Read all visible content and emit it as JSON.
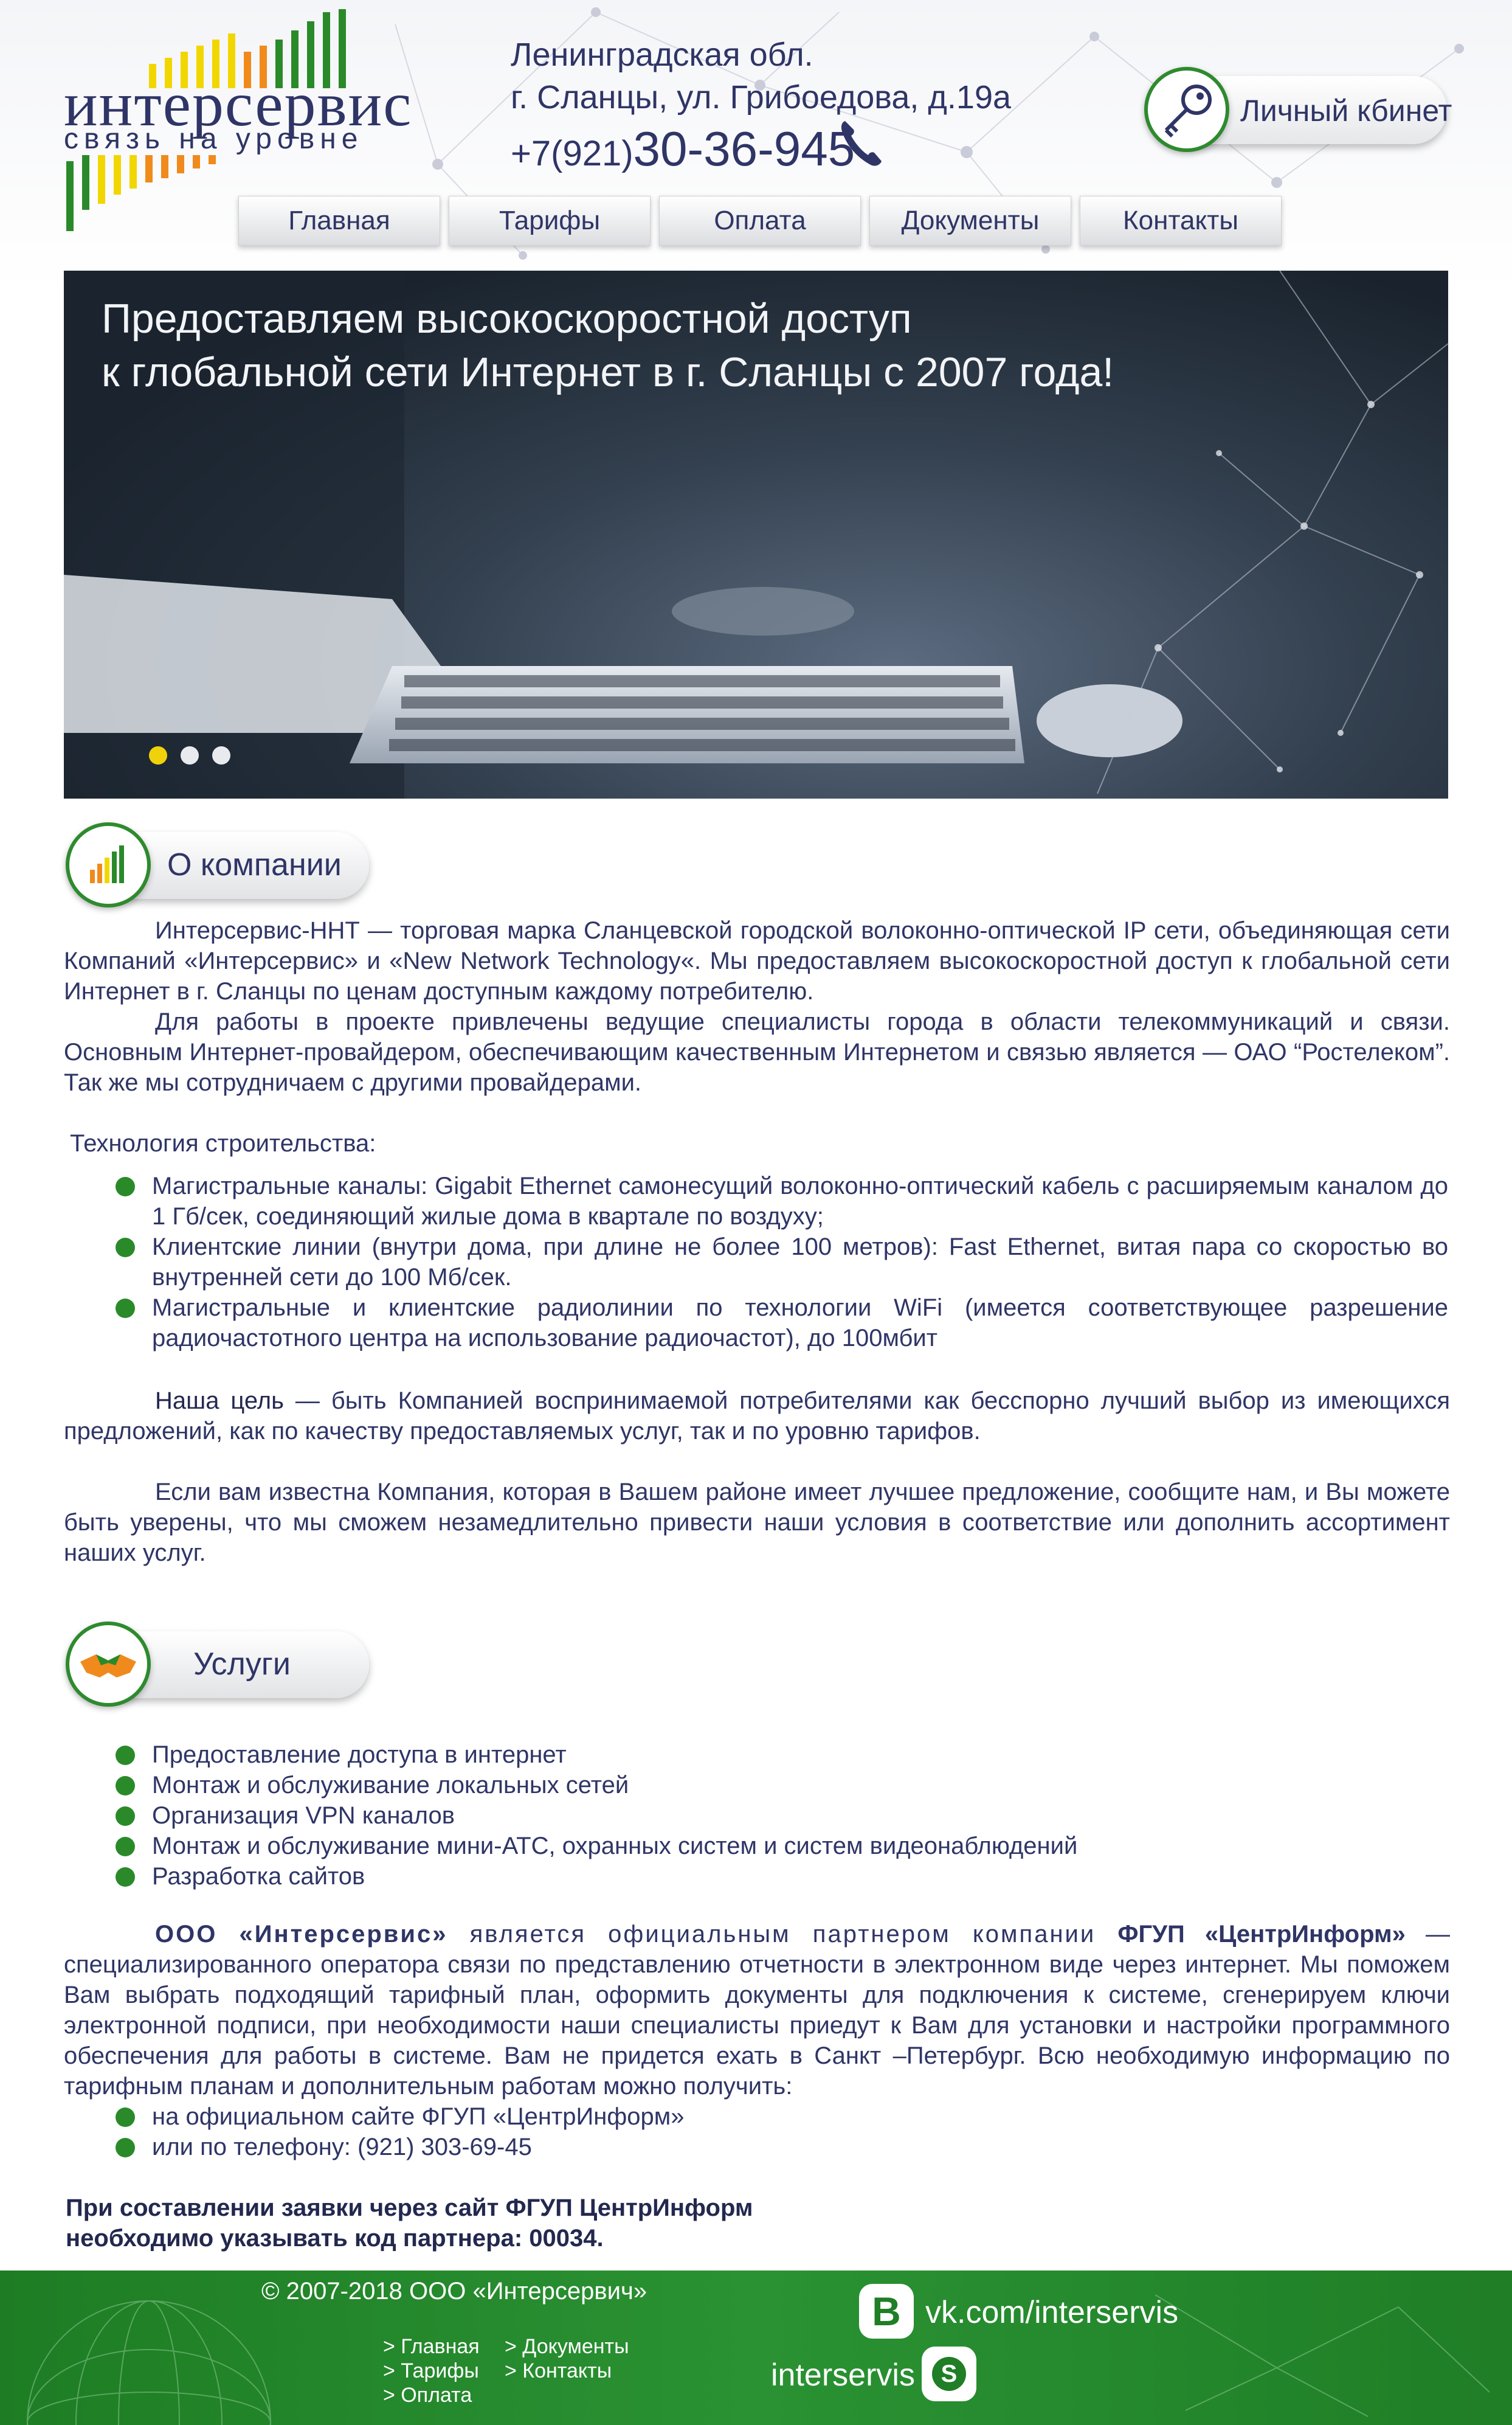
{
  "colors": {
    "brand_blue": "#2f3566",
    "brand_green": "#2a8a2a",
    "bar_yellow": "#f2d600",
    "bar_orange": "#f08a1c",
    "footer_green": "#1f7e26"
  },
  "header": {
    "logo_word": "интерсервис",
    "logo_tagline": "связь на уровне",
    "address_line1": "Ленинградская обл.",
    "address_line2": "г. Сланцы, ул. Грибоедова, д.19а",
    "phone_prefix": "+7(921)",
    "phone_number": "30-36-945",
    "phone_icon": "phone-icon",
    "cabinet_label": "Личный кбинет",
    "cabinet_icon": "key-icon"
  },
  "nav": {
    "items": [
      {
        "label": "Главная"
      },
      {
        "label": "Тарифы"
      },
      {
        "label": "Оплата"
      },
      {
        "label": "Документы"
      },
      {
        "label": "Контакты"
      }
    ]
  },
  "banner": {
    "title_line1": "Предоставляем высокоскоростной доступ",
    "title_line2": "к глобальной сети Интернет в г. Сланцы с 2007 года!",
    "slide_count": 3,
    "active_slide": 1
  },
  "about": {
    "title": "О компании",
    "icon": "signal-bars-icon",
    "p1_strong": "Интерсервис-ННТ",
    "p1": " — торговая марка Сланцевской городской волоконно-оптической IP сети, объединяющая сети Компаний «Интерсервис» и «New Network Technology«. Мы предоставляем высокоскоростной доступ к глобальной сети Интернет в г. Сланцы по ценам доступным каждому потребителю.",
    "p2": "Для работы в проекте привлечены ведущие специалисты города в области телекоммуникаций и связи. Основным Интернет-провайдером, обеспечивающим качественным Интернетом и связью является — ОАО “Ростелеком”. Так же мы сотрудничаем с другими провайдерами.",
    "tech_heading": "Технология строительства:",
    "tech_items": [
      "Магистральные каналы: Gigabit Ethernet самонесущий волоконно-оптический кабель с расширяемым каналом до 1 Гб/сек, соединяющий жилые дома в квартале по воздуху;",
      "Клиентские линии (внутри дома, при длине не более 100 метров): Fast Ethernet, витая пара со скоростью во внутренней сети до 100 Мб/сек.",
      "Магистральные и клиентские радиолинии по технологии WiFi (имеется соответствующее разрешение радиочастотного центра на использование радиочастот), до 100мбит"
    ],
    "goal_strong": "Наша цель",
    "goal": " — быть Компанией воспринимаемой потребителями как бесспорно лучший выбор из имеющихся предложений, как по качеству предоставляемых услуг, так и по уровню тарифов.",
    "offer": "Если вам известна Компания, которая в Вашем районе имеет лучшее предложение, сообщите нам, и Вы можете быть уверены, что мы сможем незамедлительно привести наши условия в соответствие или дополнить ассортимент наших услуг."
  },
  "services": {
    "title": "Услуги",
    "icon": "handshake-icon",
    "items": [
      "Предоставление доступа в интернет",
      "Монтаж и обслуживание локальных сетей",
      "Организация VPN каналов",
      "Монтаж и обслуживание мини-АТС, охранных систем и систем видеонаблюдений",
      "Разработка сайтов"
    ],
    "partner_strong1": "ООО «Интерсервис»",
    "partner_mid": " является официальным партнером компании ",
    "partner_strong2": "ФГУП «ЦентрИнформ»",
    "partner_rest": " — специализированного оператора связи по представлению отчетности в электронном виде через интернет. Мы поможем Вам выбрать подходящий тарифный план, оформить документы для подключения к системе, сгенерируем ключи электронной подписи, при необходимости наши специалисты приедут к Вам для установки и настройки программного обеспечения для работы в системе. Вам не придется ехать в Санкт –Петербург. Всю необходимую информацию по тарифным планам и дополнительным работам можно получить:",
    "contact_items": [
      "на официальном сайте ФГУП «ЦентрИнформ»",
      "или по телефону: (921) 303-69-45"
    ],
    "note_line1": "При составлении заявки через сайт ФГУП ЦентрИнформ",
    "note_line2": "необходимо указывать код партнера: 00034."
  },
  "footer": {
    "copyright": "© 2007-2018 ООО «Интерсервич»",
    "links_col1": [
      "> Главная",
      "> Тарифы",
      "> Оплата"
    ],
    "links_col2": [
      "> Документы",
      "> Контакты"
    ],
    "vk_letter": "В",
    "vk_link": "vk.com/interservis",
    "skype_name": "interservis",
    "vk_icon": "vk-icon",
    "skype_icon": "skype-icon"
  }
}
